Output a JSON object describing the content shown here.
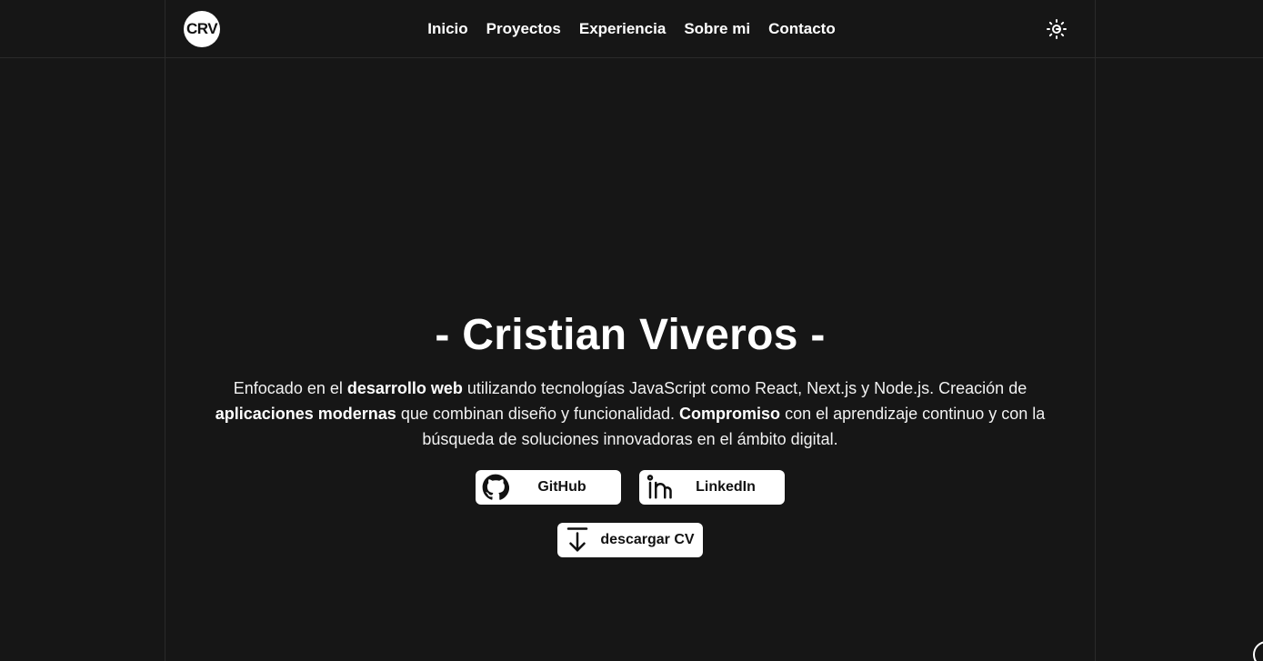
{
  "header": {
    "logo_text": "CRV",
    "nav": [
      {
        "label": "Inicio"
      },
      {
        "label": "Proyectos"
      },
      {
        "label": "Experiencia"
      },
      {
        "label": "Sobre mi"
      },
      {
        "label": "Contacto"
      }
    ],
    "theme_icon": "sun-icon"
  },
  "hero": {
    "title": "- Cristian Viveros -",
    "intro": {
      "p1": "Enfocado en el ",
      "b1": "desarrollo web",
      "p2": " utilizando tecnologías JavaScript como React, Next.js y Node.js. Creación de ",
      "b2": "aplicaciones modernas",
      "p3": " que combinan diseño y funcionalidad. ",
      "b3": "Compromiso",
      "p4": " con el aprendizaje continuo y con la búsqueda de soluciones innovadoras en el ámbito digital."
    },
    "buttons": {
      "github": {
        "label": "GitHub",
        "icon": "github-icon"
      },
      "linkedin": {
        "label": "LinkedIn",
        "icon": "linkedin-icon"
      },
      "cv": {
        "label": "descargar CV",
        "icon": "download-icon"
      }
    }
  },
  "colors": {
    "background": "#161616",
    "text": "#ffffff",
    "button_bg": "#ffffff",
    "button_text": "#111111",
    "border": "#2a2a2a"
  }
}
